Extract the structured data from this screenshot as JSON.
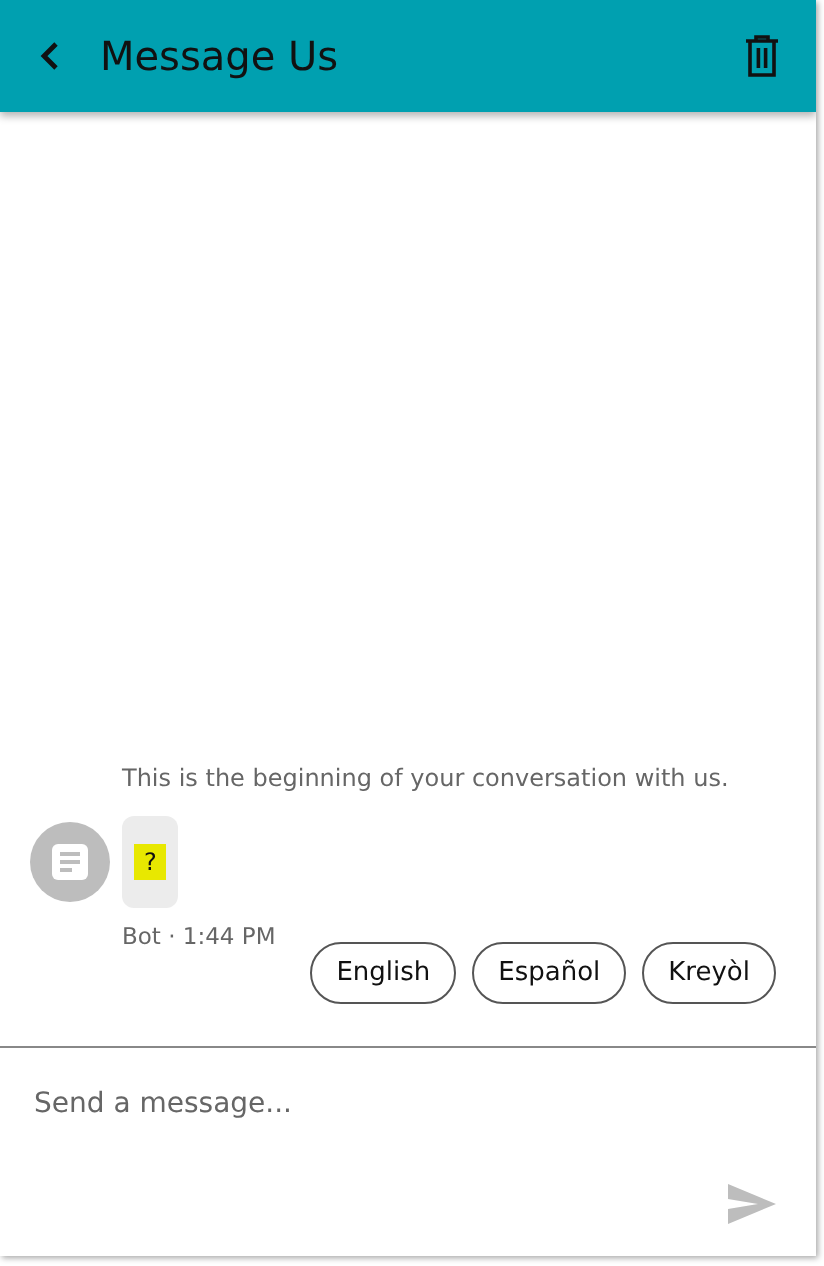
{
  "header": {
    "title": "Message Us"
  },
  "conversation": {
    "intro": "This is the beginning of your conversation with us.",
    "messages": [
      {
        "kind": "bot",
        "text": "?",
        "meta": "Bot · 1:44 PM"
      }
    ],
    "quick_replies": [
      {
        "label": "English"
      },
      {
        "label": "Español"
      },
      {
        "label": "Kreyòl"
      }
    ]
  },
  "composer": {
    "placeholder": "Send a message..."
  }
}
